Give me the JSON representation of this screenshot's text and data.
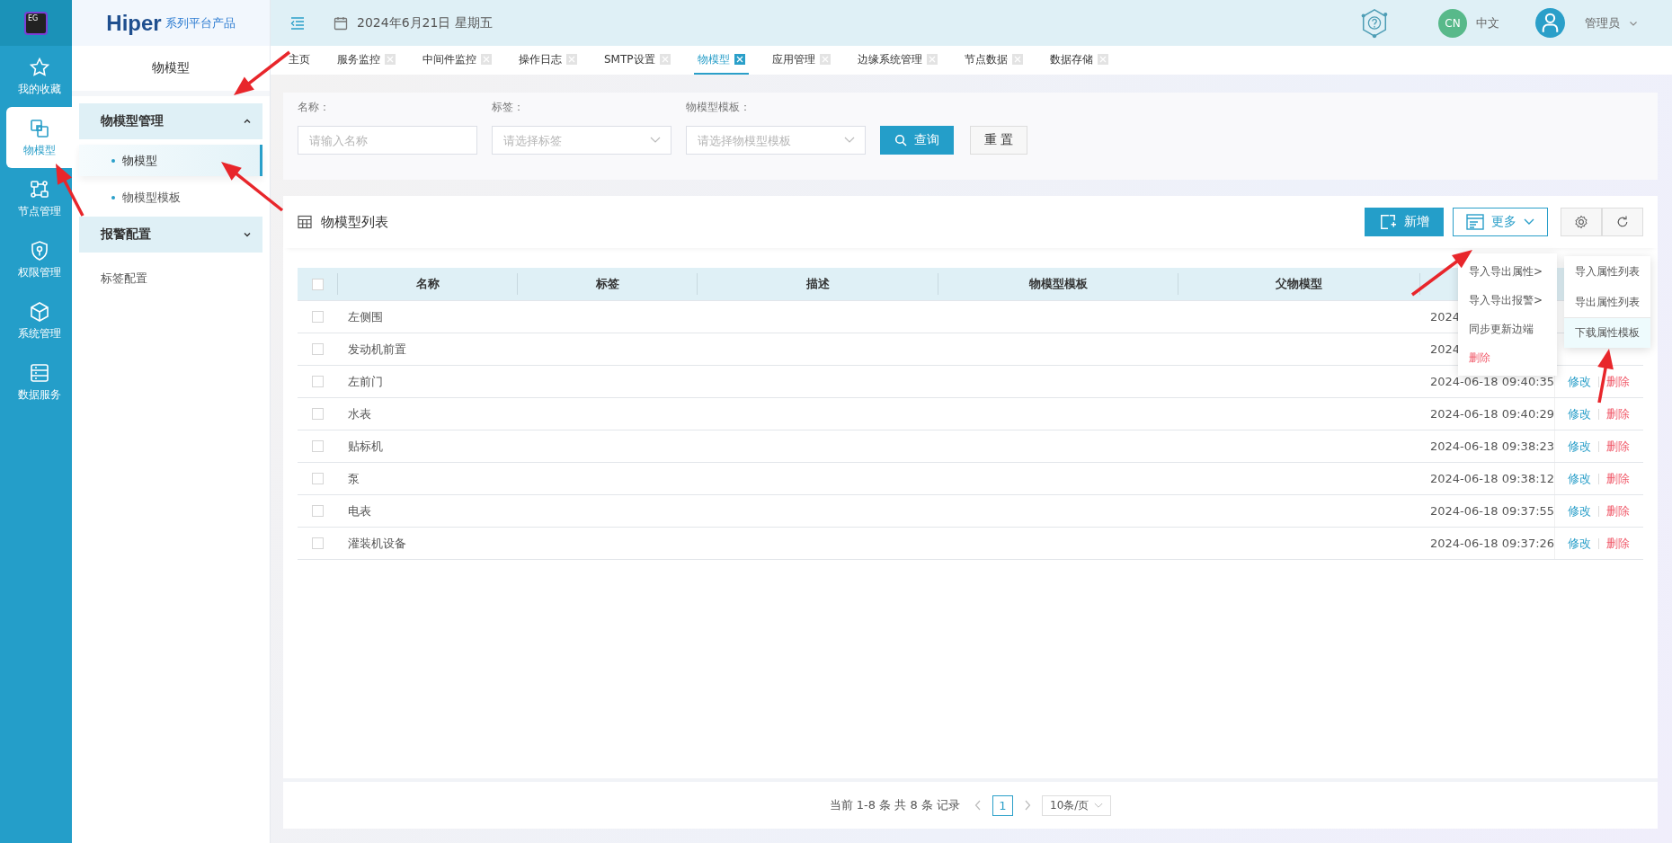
{
  "rail": {
    "logo": "EG",
    "items": [
      {
        "label": "我的收藏",
        "selected": false
      },
      {
        "label": "物模型",
        "selected": true
      },
      {
        "label": "节点管理",
        "selected": false
      },
      {
        "label": "权限管理",
        "selected": false
      },
      {
        "label": "系统管理",
        "selected": false
      },
      {
        "label": "数据服务",
        "selected": false
      }
    ]
  },
  "brand": {
    "name": "Hiper",
    "tagline": "系列平台产品"
  },
  "topbar": {
    "date": "2024年6月21日 星期五",
    "language_badge": "CN",
    "language": "中文",
    "user": "管理员"
  },
  "tabs": [
    {
      "label": "主页",
      "selected": false,
      "closable": false
    },
    {
      "label": "服务监控",
      "selected": false,
      "closable": true
    },
    {
      "label": "中间件监控",
      "selected": false,
      "closable": true
    },
    {
      "label": "操作日志",
      "selected": false,
      "closable": true
    },
    {
      "label": "SMTP设置",
      "selected": false,
      "closable": true
    },
    {
      "label": "物模型",
      "selected": true,
      "closable": true
    },
    {
      "label": "应用管理",
      "selected": false,
      "closable": true
    },
    {
      "label": "边缘系统管理",
      "selected": false,
      "closable": true
    },
    {
      "label": "节点数据",
      "selected": false,
      "closable": true
    },
    {
      "label": "数据存储",
      "selected": false,
      "closable": true
    }
  ],
  "sidebar": {
    "title": "物模型",
    "items": [
      {
        "kind": "group",
        "label": "物模型管理",
        "expanded": true,
        "children": [
          {
            "label": "物模型",
            "selected": true
          },
          {
            "label": "物模型模板",
            "selected": false
          }
        ]
      },
      {
        "kind": "group",
        "label": "报警配置",
        "expanded": false
      },
      {
        "kind": "link",
        "label": "标签配置"
      }
    ]
  },
  "filters": [
    {
      "kind": "input",
      "label": "名称：",
      "placeholder": "请输入名称"
    },
    {
      "kind": "select",
      "label": "标签：",
      "placeholder": "请选择标签"
    },
    {
      "kind": "select",
      "label": "物模型模板：",
      "placeholder": "请选择物模型模板"
    }
  ],
  "search_button": "查询",
  "reset_button": "重 置",
  "table": {
    "title": "物模型列表",
    "add_button": "新增",
    "more_button": "更多",
    "all_checked": false,
    "columns": [
      "名称",
      "标签",
      "描述",
      "物模型模板",
      "父物模型"
    ],
    "rows": [
      {
        "checked": false,
        "name": "左侧围",
        "time": "2024"
      },
      {
        "checked": false,
        "name": "发动机前置",
        "time": "2024"
      },
      {
        "checked": false,
        "name": "左前门",
        "time": "2024-06-18 09:40:35",
        "actions": [
          {
            "kind": "edit",
            "label": "修改"
          },
          {
            "kind": "delete",
            "label": "删除"
          }
        ]
      },
      {
        "checked": false,
        "name": "水表",
        "time": "2024-06-18 09:40:29",
        "actions": [
          {
            "kind": "edit",
            "label": "修改"
          },
          {
            "kind": "delete",
            "label": "删除"
          }
        ]
      },
      {
        "checked": false,
        "name": "贴标机",
        "time": "2024-06-18 09:38:23",
        "actions": [
          {
            "kind": "edit",
            "label": "修改"
          },
          {
            "kind": "delete",
            "label": "删除"
          }
        ]
      },
      {
        "checked": false,
        "name": "泵",
        "time": "2024-06-18 09:38:12",
        "actions": [
          {
            "kind": "edit",
            "label": "修改"
          },
          {
            "kind": "delete",
            "label": "删除"
          }
        ]
      },
      {
        "checked": false,
        "name": "电表",
        "time": "2024-06-18 09:37:55",
        "actions": [
          {
            "kind": "edit",
            "label": "修改"
          },
          {
            "kind": "delete",
            "label": "删除"
          }
        ]
      },
      {
        "checked": false,
        "name": "灌装机设备",
        "time": "2024-06-18 09:37:26",
        "actions": [
          {
            "kind": "edit",
            "label": "修改"
          },
          {
            "kind": "delete",
            "label": "删除"
          }
        ]
      }
    ]
  },
  "more_menu": [
    {
      "kind": "submenu",
      "label": "导入导出属性>"
    },
    {
      "kind": "submenu",
      "label": "导入导出报警>"
    },
    {
      "kind": "action",
      "label": "同步更新边端"
    },
    {
      "kind": "danger",
      "label": "删除"
    }
  ],
  "submenu": [
    {
      "label": "导入属性列表",
      "selected": false
    },
    {
      "label": "导出属性列表",
      "selected": false
    },
    {
      "label": "下载属性模板",
      "selected": true
    }
  ],
  "pagination": {
    "summary": "当前 1-8 条 共 8 条 记录",
    "page": "1",
    "page_size": "10条/页"
  }
}
